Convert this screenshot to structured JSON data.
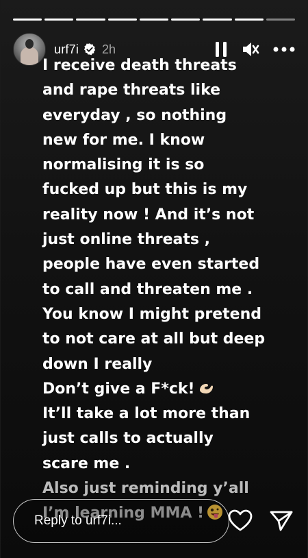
{
  "progress": {
    "segments": 9,
    "completed": 8
  },
  "header": {
    "username": "urf7i",
    "time": "2h",
    "icons": [
      "pause-icon",
      "mute-icon",
      "more-icon"
    ]
  },
  "story": {
    "lines": [
      "I receive death threats",
      "and rape threats like",
      "everyday , so nothing",
      "new for me. I know",
      "normalising it is so",
      "fucked up but this is my",
      "reality now ! And it’s not",
      "just online threats ,",
      "people have even started",
      "to call and threaten me .",
      "You know I might pretend",
      "to not care at all but deep",
      "down I really",
      "Don’t give a F*ck!",
      "It’ll take a lot more than",
      "just calls to actually",
      "scare me .",
      "Also just reminding y’all",
      "I’m learning MMA !"
    ],
    "emojis": {
      "hand": "pinching-hand-emoji",
      "face": "zany-face-emoji"
    }
  },
  "footer": {
    "reply_placeholder": "Reply to urf7i...",
    "icons": [
      "heart-icon",
      "send-icon"
    ]
  },
  "colors": {
    "background": "#121212",
    "text": "#ffffff",
    "muted": "#9a9a9a"
  }
}
